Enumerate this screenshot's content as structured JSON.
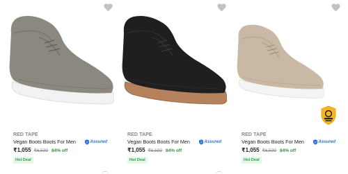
{
  "products": [
    {
      "brand": "RED TAPE",
      "title": "Vegan Boots Boots For Men",
      "price": "₹1,055",
      "mrp": "₹6,599",
      "discount": "84% off",
      "tag": "Hot Deal",
      "assured_label": "Assured",
      "shoe_color": "#8b8880",
      "sole_color": "#f2f2f2",
      "wishlist_icon": "heart-icon"
    },
    {
      "brand": "RED TAPE",
      "title": "Vegan Boots Boots For Men",
      "price": "₹1,055",
      "mrp": "₹6,599",
      "discount": "84% off",
      "tag": "Hot Deal",
      "assured_label": "Assured",
      "shoe_color": "#1f1f1f",
      "sole_color": "#b5825d",
      "wishlist_icon": "heart-icon"
    },
    {
      "brand": "RED TAPE",
      "title": "Vegan Boots Boots For Men",
      "price": "₹1,055",
      "mrp": "₹6,599",
      "discount": "84% off",
      "tag": "Hot Deal",
      "assured_label": "Assured",
      "shoe_color": "#c9b8a3",
      "sole_color": "#f4f4f4",
      "wishlist_icon": "heart-icon"
    }
  ],
  "badge": {
    "icon": "award-badge-icon",
    "color": "#f6b51e"
  },
  "colors": {
    "discount_green": "#388e3c",
    "assured_blue": "#2874f0",
    "hotdeal_bg": "#e6f6ea"
  }
}
